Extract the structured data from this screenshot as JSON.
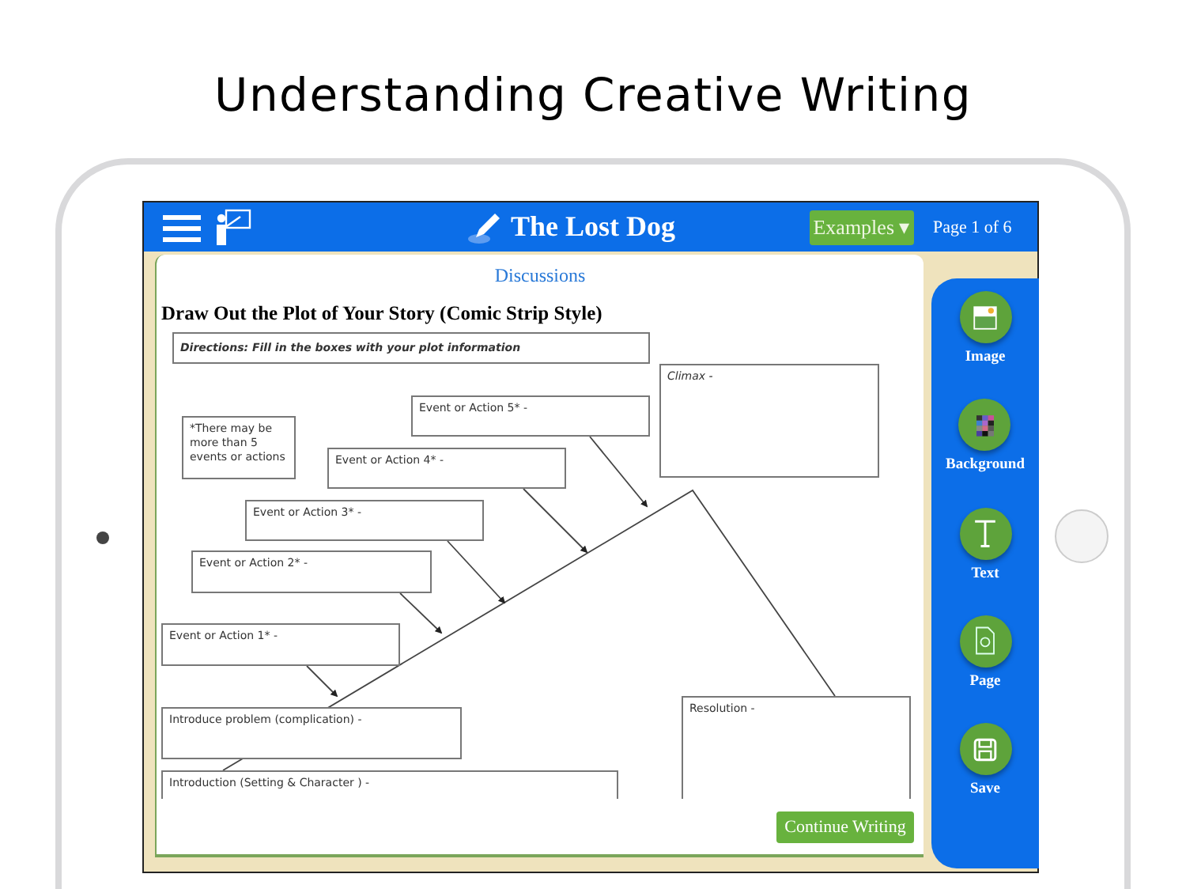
{
  "headline": "Understanding Creative Writing",
  "header": {
    "title": "The Lost Dog",
    "examples_button": "Examples ▾",
    "page_indicator": "Page 1 of 6"
  },
  "worksheet": {
    "link": "Discussions",
    "title": "Draw Out the Plot of Your Story (Comic Strip Style)",
    "boxes": [
      {
        "kind": "directions",
        "label": "Directions:  Fill in the boxes with your plot information"
      },
      {
        "kind": "note",
        "label": "*There may be more than 5 events or actions"
      },
      {
        "kind": "climax",
        "label": "Climax -"
      },
      {
        "kind": "event",
        "label": "Event or Action 5* -"
      },
      {
        "kind": "event",
        "label": "Event or Action 4* -"
      },
      {
        "kind": "event",
        "label": "Event or Action 3* -"
      },
      {
        "kind": "event",
        "label": "Event or Action 2* -"
      },
      {
        "kind": "event",
        "label": "Event or Action 1* -"
      },
      {
        "kind": "problem",
        "label": "Introduce problem (complication) -"
      },
      {
        "kind": "introduction",
        "label": "Introduction (Setting & Character ) -"
      },
      {
        "kind": "resolution",
        "label": "Resolution -"
      }
    ],
    "continue_button": "Continue Writing"
  },
  "tools": [
    {
      "kind": "image",
      "label": "Image"
    },
    {
      "kind": "background",
      "label": "Background"
    },
    {
      "kind": "text",
      "label": "Text"
    },
    {
      "kind": "page",
      "label": "Page"
    },
    {
      "kind": "save",
      "label": "Save"
    }
  ]
}
